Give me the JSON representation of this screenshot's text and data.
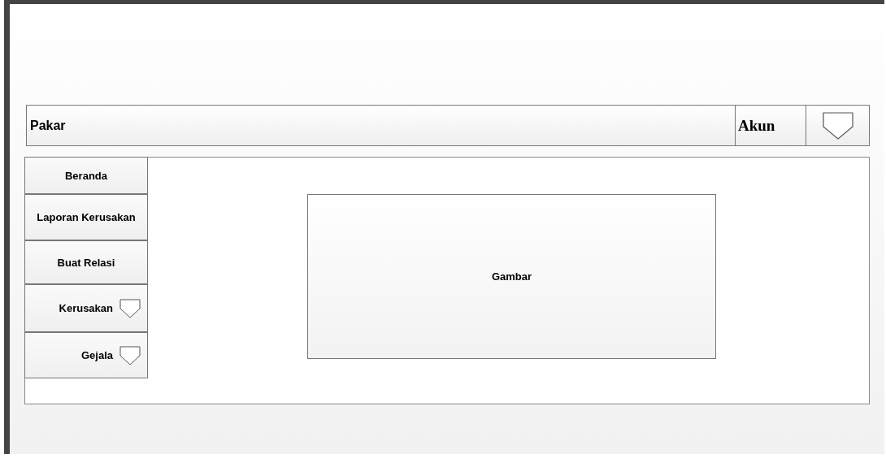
{
  "topbar": {
    "title": "Pakar",
    "account": "Akun"
  },
  "menu": [
    {
      "label": "Beranda",
      "kind": "button"
    },
    {
      "label": "Laporan Kerusakan",
      "kind": "button"
    },
    {
      "label": "Buat Relasi",
      "kind": "button"
    },
    {
      "label": "Kerusakan",
      "kind": "dropdown"
    },
    {
      "label": "Gejala",
      "kind": "dropdown"
    }
  ],
  "content": {
    "image_label": "Gambar"
  }
}
